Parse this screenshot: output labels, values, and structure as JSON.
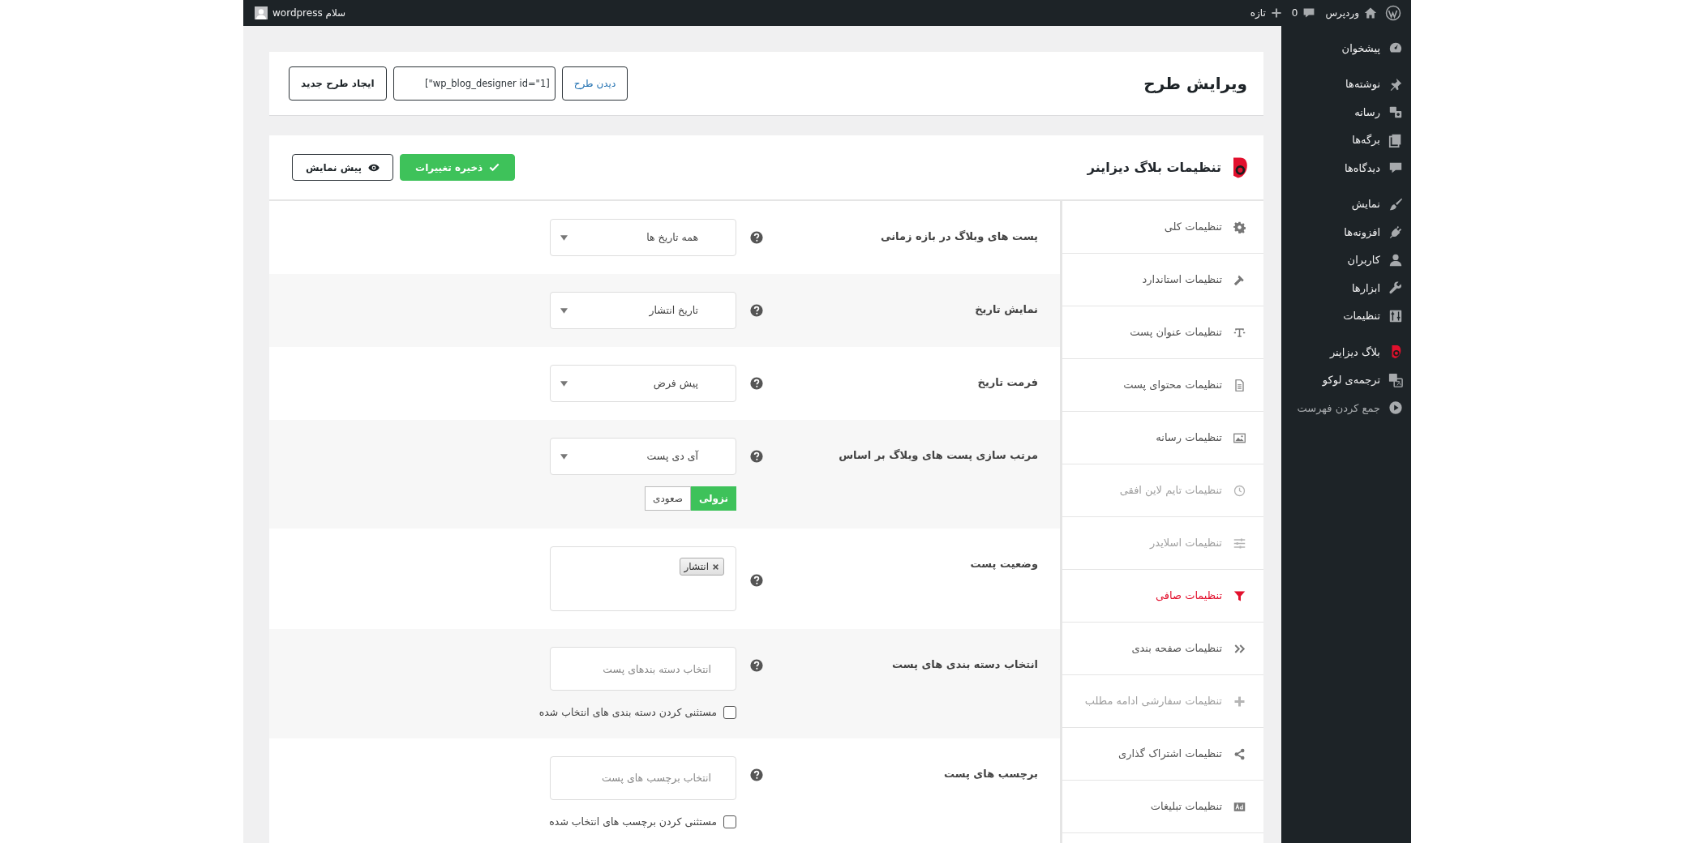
{
  "top_bar": {
    "site": "وردپرس",
    "comments": "0",
    "new": "تازه",
    "greeting": "سلام wordpress"
  },
  "admin_menu": {
    "groups": [
      {
        "items": [
          {
            "label": "پیشخوان",
            "kind": "link"
          }
        ]
      },
      {
        "items": [
          {
            "label": "نوشته‌ها",
            "kind": "link"
          },
          {
            "label": "رسانه",
            "kind": "link"
          },
          {
            "label": "برگه‌ها",
            "kind": "link"
          },
          {
            "label": "دیدگاه‌ها",
            "kind": "link"
          }
        ]
      },
      {
        "items": [
          {
            "label": "نمایش",
            "kind": "link"
          },
          {
            "label": "افزونه‌ها",
            "kind": "link"
          },
          {
            "label": "کاربران",
            "kind": "link"
          },
          {
            "label": "ابزارها",
            "kind": "link"
          },
          {
            "label": "تنظیمات",
            "kind": "link"
          }
        ]
      },
      {
        "items": [
          {
            "label": "بلاگ دیزاینر",
            "kind": "link"
          },
          {
            "label": "ترجمه‌ی لوکو",
            "kind": "link"
          },
          {
            "label": "جمع کردن فهرست",
            "kind": "collapse"
          }
        ]
      }
    ]
  },
  "header": {
    "title": "ویرایش طرح",
    "view_button": "دیدن طرح",
    "shortcode": "[wp_blog_designer id=\"1\"]",
    "new_button": "ایجاد طرح جدید"
  },
  "settings": {
    "title": "تنظیمات بلاگ دیزاینر",
    "save_button": "ذخیره تغییرات",
    "preview_button": "پیش نمایش",
    "nav": [
      {
        "label": "تنظیمات کلی",
        "selected": false,
        "disabled": false
      },
      {
        "label": "تنظیمات استاندارد",
        "selected": false,
        "disabled": false
      },
      {
        "label": "تنظیمات عنوان پست",
        "selected": false,
        "disabled": false
      },
      {
        "label": "تنظیمات محتوای پست",
        "selected": false,
        "disabled": false
      },
      {
        "label": "تنظیمات رسانه",
        "selected": false,
        "disabled": false
      },
      {
        "label": "تنظیمات تایم لاین افقی",
        "selected": false,
        "disabled": true
      },
      {
        "label": "تنظیمات اسلایدر",
        "selected": false,
        "disabled": true
      },
      {
        "label": "تنظیمات صافی",
        "selected": true,
        "disabled": false
      },
      {
        "label": "تنظیمات صفحه بندی",
        "selected": false,
        "disabled": false
      },
      {
        "label": "تنظیمات سفارشی ادامه مطلب",
        "selected": false,
        "disabled": true
      },
      {
        "label": "تنظیمات اشتراک گذاری",
        "selected": false,
        "disabled": false
      },
      {
        "label": "تنظیمات تبلیغات",
        "selected": false,
        "disabled": false
      }
    ],
    "rows": [
      {
        "kind": "select",
        "label": "پست های وبلاگ در بازه زمانی",
        "value": "همه تاریخ ها"
      },
      {
        "kind": "select",
        "label": "نمایش تاریخ",
        "value": "تاریخ انتشار"
      },
      {
        "kind": "select",
        "label": "فرمت تاریخ",
        "value": "پیش فرض"
      },
      {
        "kind": "select_order",
        "label": "مرتب سازی پست های وبلاگ بر اساس",
        "value": "آی دی پست",
        "order": [
          {
            "label": "نزولی",
            "selected": true
          },
          {
            "label": "صعودی",
            "selected": false
          }
        ]
      },
      {
        "kind": "tags",
        "label": "وضعیت پست",
        "tags": [
          "انتشار"
        ]
      },
      {
        "kind": "search_checkbox",
        "label": "انتخاب دسته بندی های پست",
        "placeholder": "انتخاب دسته بندهای پست",
        "checkbox": {
          "label": "مستثنی کردن دسته بندی های انتخاب شده",
          "checked": false
        }
      },
      {
        "kind": "search_checkbox",
        "label": "برچسب های پست",
        "placeholder": "انتخاب برچسب های پست",
        "checkbox": {
          "label": "مستثنی کردن برچسب های انتخاب شده",
          "checked": false
        }
      }
    ]
  }
}
